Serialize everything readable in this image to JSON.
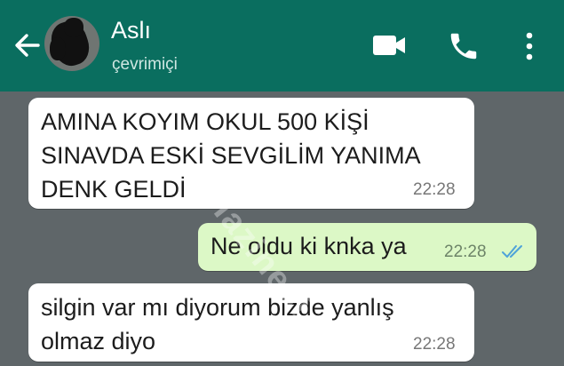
{
  "header": {
    "contact_name": "Aslı",
    "status": "çevrimiçi",
    "back_icon": "arrow-left-icon",
    "video_icon": "video-camera-icon",
    "call_icon": "phone-icon",
    "menu_icon": "more-vertical-icon",
    "color": "#0a6e5f"
  },
  "messages": [
    {
      "direction": "incoming",
      "text": "AMINA KOYIM OKUL 500 KİŞİ\nSINAVDA ESKİ SEVGİLİM YANIMA\nDENK GELDİ",
      "time": "22:28"
    },
    {
      "direction": "outgoing",
      "text": "Ne oldu ki knka ya",
      "time": "22:28",
      "status_icon": "double-check-icon"
    },
    {
      "direction": "incoming",
      "text": "silgin var mı diyorum bizde yanlış\nolmaz diyo",
      "time": "22:28"
    }
  ],
  "watermark": "Hazinesi"
}
